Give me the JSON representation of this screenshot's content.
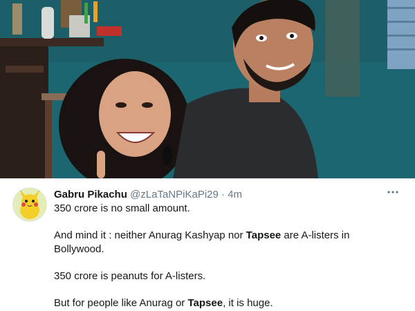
{
  "photo": {
    "icon": "photo-of-two-people-smiling"
  },
  "tweet": {
    "author_name": "Gabru Pikachu",
    "handle": "@zLaTaNPiKaPi29",
    "separator": "·",
    "time": "4m",
    "more_icon": "more-options-icon",
    "avatar_icon": "pikachu-avatar",
    "line1": "350 crore is no small amount.",
    "line2_pre": "And mind it : neither Anurag Kashyap nor ",
    "line2_bold": "Tapsee",
    "line2_post": " are A-listers in Bollywood.",
    "line3": "350 crore is peanuts for A-listers.",
    "line4_pre": "But for people like Anurag or ",
    "line4_bold": "Tapsee",
    "line4_post": ", it is huge."
  },
  "colors": {
    "text_primary": "#14171a",
    "text_secondary": "#657786",
    "wall_teal": "#1a6b74"
  }
}
